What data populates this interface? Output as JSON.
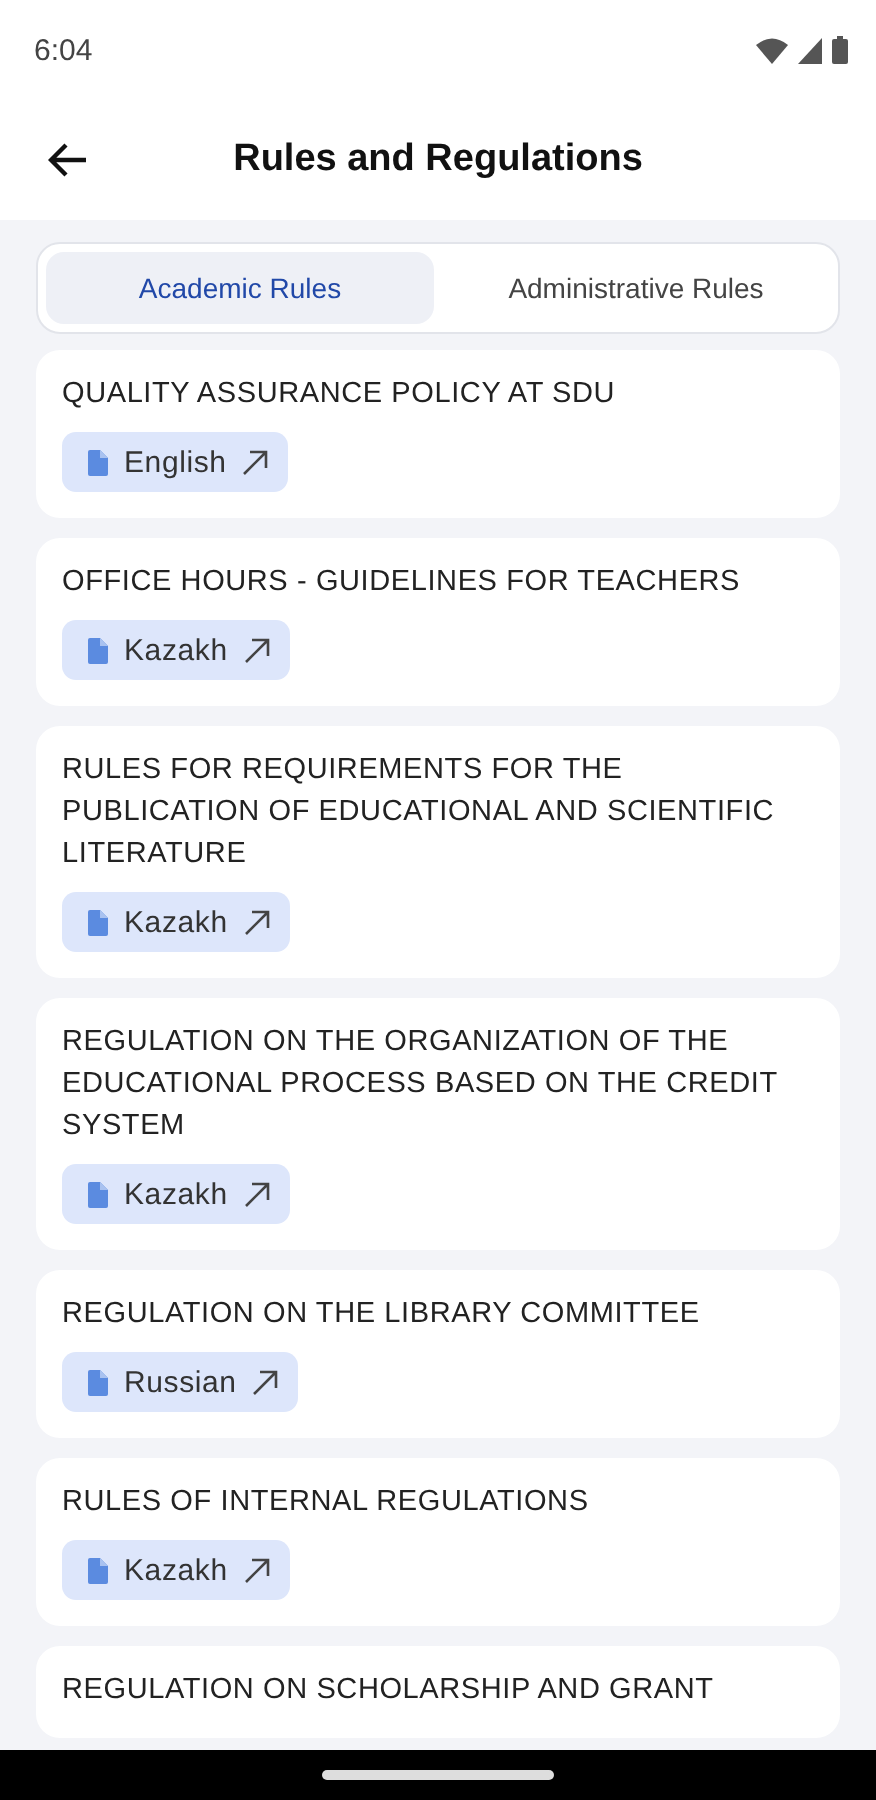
{
  "status_bar": {
    "time": "6:04"
  },
  "header": {
    "title": "Rules and Regulations"
  },
  "tabs": [
    {
      "label": "Academic Rules",
      "selected": true
    },
    {
      "label": "Administrative Rules",
      "selected": false
    }
  ],
  "documents": [
    {
      "title": "QUALITY ASSURANCE POLICY AT SDU",
      "language": "English"
    },
    {
      "title": "OFFICE HOURS - GUIDELINES FOR TEACHERS",
      "language": "Kazakh"
    },
    {
      "title": "RULES FOR REQUIREMENTS FOR THE PUBLICATION OF EDUCATIONAL AND SCIENTIFIC LITERATURE",
      "language": "Kazakh"
    },
    {
      "title": "REGULATION ON THE ORGANIZATION OF THE EDUCATIONAL PROCESS BASED ON THE CREDIT SYSTEM",
      "language": "Kazakh"
    },
    {
      "title": "REGULATION ON THE LIBRARY COMMITTEE",
      "language": "Russian"
    },
    {
      "title": "RULES OF INTERNAL REGULATIONS",
      "language": "Kazakh"
    },
    {
      "title": "REGULATION ON SCHOLARSHIP AND GRANT"
    }
  ]
}
